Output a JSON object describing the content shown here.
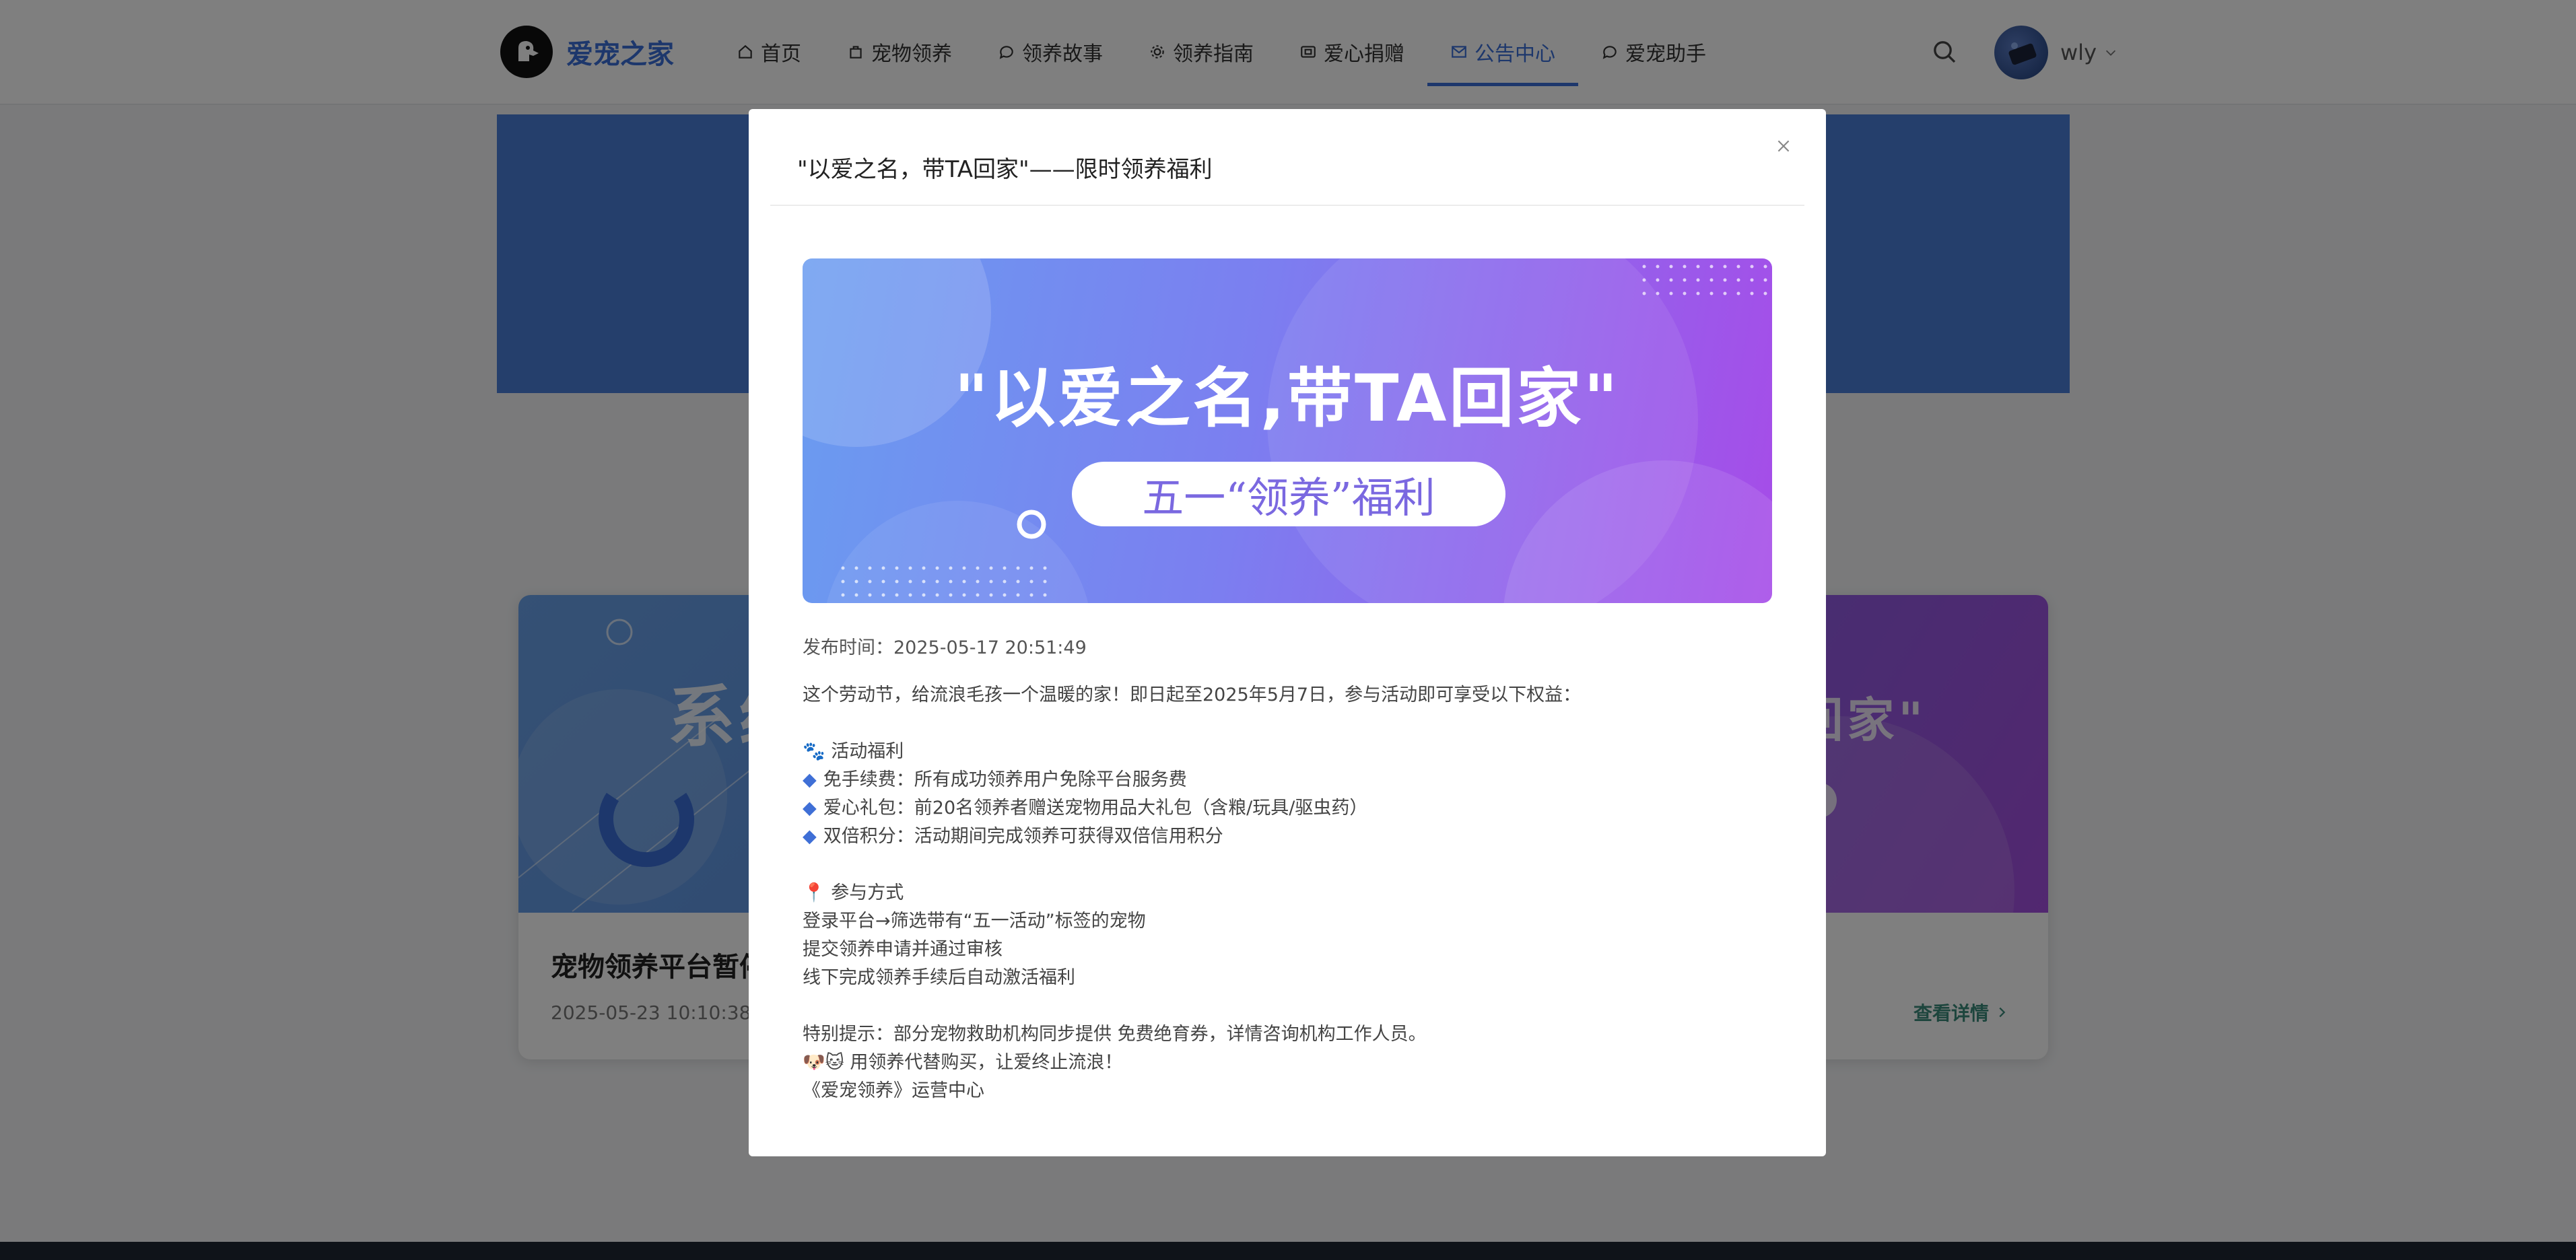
{
  "header": {
    "logo_text": "爱宠之家",
    "nav": [
      {
        "label": "首页",
        "icon": "home-icon"
      },
      {
        "label": "宠物领养",
        "icon": "bag-icon"
      },
      {
        "label": "领养故事",
        "icon": "chat-bubble-icon"
      },
      {
        "label": "领养指南",
        "icon": "gear-icon"
      },
      {
        "label": "爱心捐赠",
        "icon": "wallet-icon"
      },
      {
        "label": "公告中心",
        "icon": "mail-icon",
        "active": true
      },
      {
        "label": "爱宠助手",
        "icon": "chat-bubble-icon"
      }
    ],
    "username": "wly"
  },
  "cards": [
    {
      "title": "宠物领养平台暂停",
      "date": "2025-05-23 10:10:38",
      "image_text": "系统"
    },
    {
      "image_text": "回家\"",
      "link": "查看详情"
    }
  ],
  "modal": {
    "title": "\"以爱之名，带TA回家\"——限时领养福利",
    "banner_headline": "\"以爱之名,带TA回家\"",
    "banner_pill": "五一“领养”福利",
    "publish_label": "发布时间：",
    "publish_time": "2025-05-17 20:51:49",
    "intro": "这个劳动节，给流浪毛孩一个温暖的家！即日起至2025年5月7日，参与活动即可享受以下权益：",
    "benefits_heading": "🐾 活动福利",
    "benefits": [
      "免手续费：所有成功领养用户免除平台服务费",
      "爱心礼包：前20名领养者赠送宠物用品大礼包（含粮/玩具/驱虫药）",
      "双倍积分：活动期间完成领养可获得双倍信用积分"
    ],
    "steps_heading": "📍 参与方式",
    "steps": [
      "登录平台→筛选带有“五一活动”标签的宠物",
      "提交领养申请并通过审核",
      "线下完成领养手续后自动激活福利"
    ],
    "tip": "特别提示：部分宠物救助机构同步提供 免费绝育券，详情咨询机构工作人员。",
    "slogan": "🐶🐱 用领养代替购买，让爱终止流浪！",
    "signature": "《爱宠领养》运营中心"
  }
}
